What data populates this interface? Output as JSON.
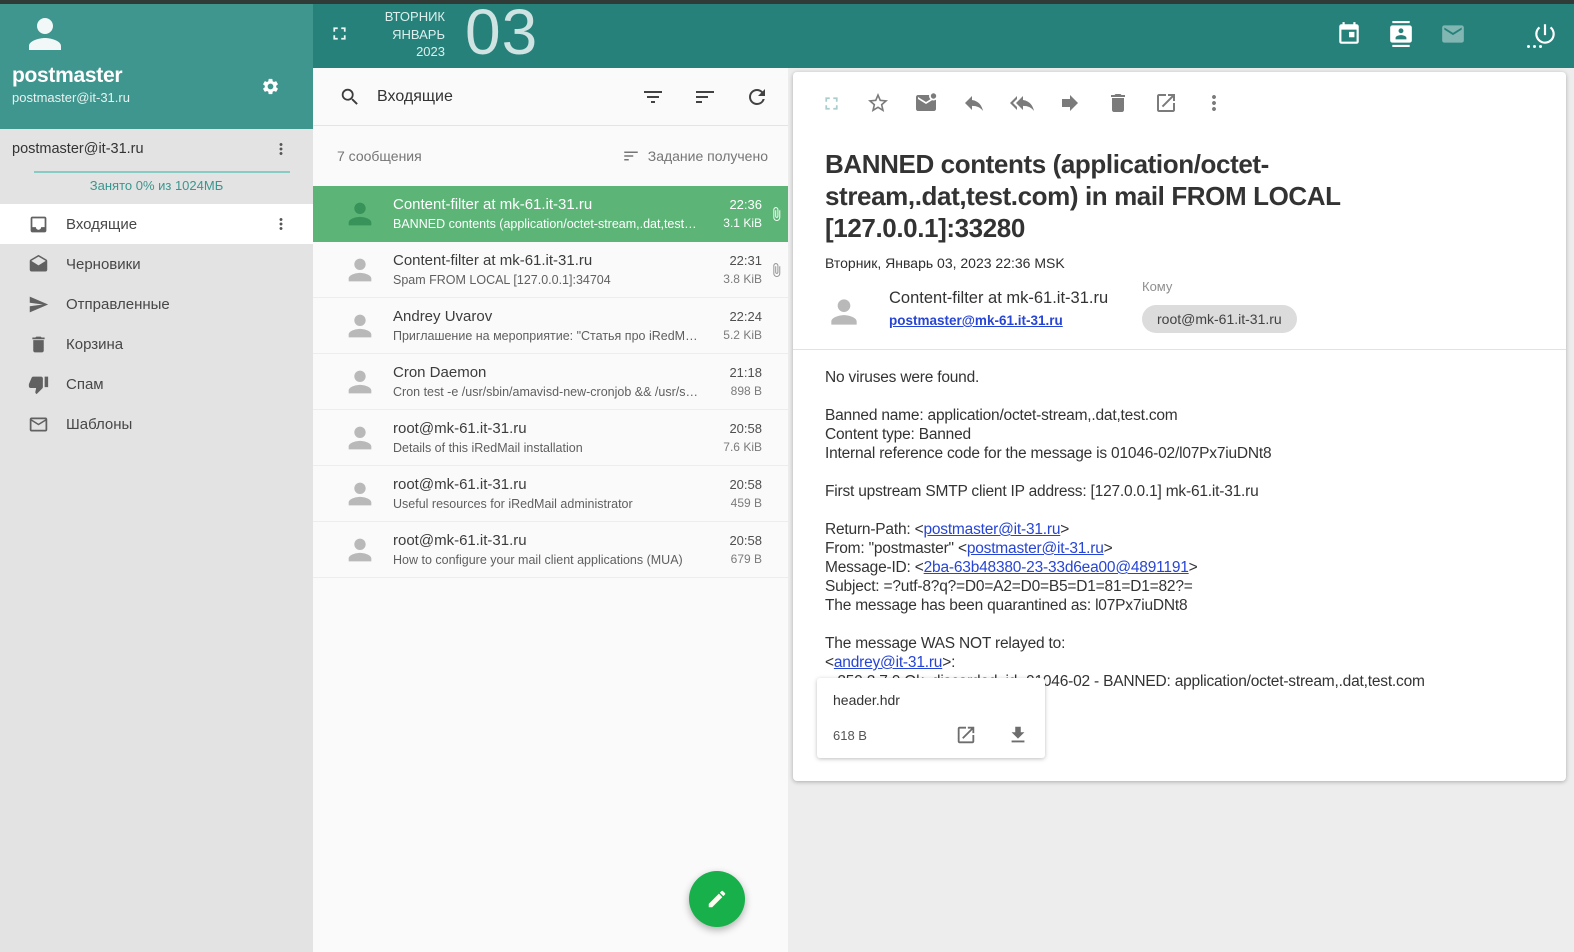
{
  "colors": {
    "topbar_teal": "#27817b",
    "sidebar_teal": "#3f968e",
    "selected_row_green": "#5cb577",
    "fab_green": "#17b04a",
    "link_blue": "#2745d4",
    "quota_bar_teal": "#86ccc5"
  },
  "topbar": {
    "weekday": "ВТОРНИК",
    "month": "ЯНВАРЬ",
    "year": "2023",
    "day": "03",
    "icons": [
      "fullscreen-icon",
      "calendar-icon",
      "contacts-icon",
      "mail-icon",
      "power-icon"
    ]
  },
  "sidebar": {
    "user": {
      "name": "postmaster",
      "email": "postmaster@it-31.ru"
    },
    "account": {
      "label": "postmaster@it-31.ru",
      "quota_text": "Занято 0% из 1024МБ"
    },
    "folders": [
      {
        "id": "inbox",
        "label": "Входящие",
        "icon": "inbox-icon",
        "selected": true
      },
      {
        "id": "drafts",
        "label": "Черновики",
        "icon": "drafts-icon",
        "selected": false
      },
      {
        "id": "sent",
        "label": "Отправленные",
        "icon": "send-icon",
        "selected": false
      },
      {
        "id": "trash",
        "label": "Корзина",
        "icon": "trash-icon",
        "selected": false
      },
      {
        "id": "spam",
        "label": "Спам",
        "icon": "thumb-down-icon",
        "selected": false
      },
      {
        "id": "templates",
        "label": "Шаблоны",
        "icon": "envelope-icon",
        "selected": false
      }
    ]
  },
  "list": {
    "search_label": "Входящие",
    "count_text": "7 сообщения",
    "sort_text": "Задание получено",
    "messages": [
      {
        "sender": "Content-filter at mk-61.it-31.ru",
        "preview": "BANNED contents (application/octet-stream,.dat,test.com) i...",
        "time": "22:36",
        "size": "3.1 KiB",
        "attachment": true,
        "selected": true
      },
      {
        "sender": "Content-filter at mk-61.it-31.ru",
        "preview": "Spam FROM LOCAL [127.0.0.1]:34704",
        "time": "22:31",
        "size": "3.8 KiB",
        "attachment": true,
        "selected": false
      },
      {
        "sender": "Andrey Uvarov",
        "preview": "Приглашение на мероприятие: \"Статья про iRedMail\"",
        "time": "22:24",
        "size": "5.2 KiB",
        "attachment": false,
        "selected": false
      },
      {
        "sender": "Cron Daemon",
        "preview": "Cron test -e /usr/sbin/amavisd-new-cronjob && /usr/sbin...",
        "time": "21:18",
        "size": "898 B",
        "attachment": false,
        "selected": false
      },
      {
        "sender": "root@mk-61.it-31.ru",
        "preview": "Details of this iRedMail installation",
        "time": "20:58",
        "size": "7.6 KiB",
        "attachment": false,
        "selected": false
      },
      {
        "sender": "root@mk-61.it-31.ru",
        "preview": "Useful resources for iRedMail administrator",
        "time": "20:58",
        "size": "459 B",
        "attachment": false,
        "selected": false
      },
      {
        "sender": "root@mk-61.it-31.ru",
        "preview": "How to configure your mail client applications (MUA)",
        "time": "20:58",
        "size": "679 B",
        "attachment": false,
        "selected": false
      }
    ]
  },
  "viewer": {
    "toolbar_icons": [
      "fullscreen-icon",
      "star-icon",
      "mark-unread-icon",
      "reply-icon",
      "reply-all-icon",
      "forward-icon",
      "delete-icon",
      "open-in-new-icon",
      "more-vert-icon"
    ],
    "subject": "BANNED contents (application/octet-stream,.dat,test.com) in mail FROM LOCAL [127.0.0.1]:33280",
    "date": "Вторник, Январь 03, 2023 22:36 MSK",
    "from_name": "Content-filter at mk-61.it-31.ru",
    "from_email": "postmaster@mk-61.it-31.ru",
    "to_label": "Кому",
    "to_chip": "root@mk-61.it-31.ru",
    "body_lines": [
      [
        {
          "t": "No viruses were found."
        }
      ],
      [],
      [
        {
          "t": "Banned name: application/octet-stream,.dat,test.com"
        }
      ],
      [
        {
          "t": "Content type: Banned"
        }
      ],
      [
        {
          "t": "Internal reference code for the message is 01046-02/l07Px7iuDNt8"
        }
      ],
      [],
      [
        {
          "t": "First upstream SMTP client IP address: [127.0.0.1] mk-61.it-31.ru"
        }
      ],
      [],
      [
        {
          "t": "Return-Path: <"
        },
        {
          "t": "postmaster@it-31.ru",
          "link": true
        },
        {
          "t": ">"
        }
      ],
      [
        {
          "t": "From: \"postmaster\" <"
        },
        {
          "t": "postmaster@it-31.ru",
          "link": true
        },
        {
          "t": ">"
        }
      ],
      [
        {
          "t": "Message-ID: <"
        },
        {
          "t": "2ba-63b48380-23-33d6ea00@4891191",
          "link": true
        },
        {
          "t": ">"
        }
      ],
      [
        {
          "t": "Subject: =?utf-8?q?=D0=A2=D0=B5=D1=81=D1=82?="
        }
      ],
      [
        {
          "t": "The message has been quarantined as: l07Px7iuDNt8"
        }
      ],
      [],
      [
        {
          "t": "The message WAS NOT relayed to:"
        }
      ],
      [
        {
          "t": "<"
        },
        {
          "t": "andrey@it-31.ru",
          "link": true
        },
        {
          "t": ">:"
        }
      ],
      [
        {
          "t": "   250 2.7.0 Ok, discarded, id=01046-02 - BANNED: application/octet-stream,.dat,test.com"
        }
      ]
    ],
    "attachment": {
      "name": "header.hdr",
      "size": "618 B"
    }
  }
}
